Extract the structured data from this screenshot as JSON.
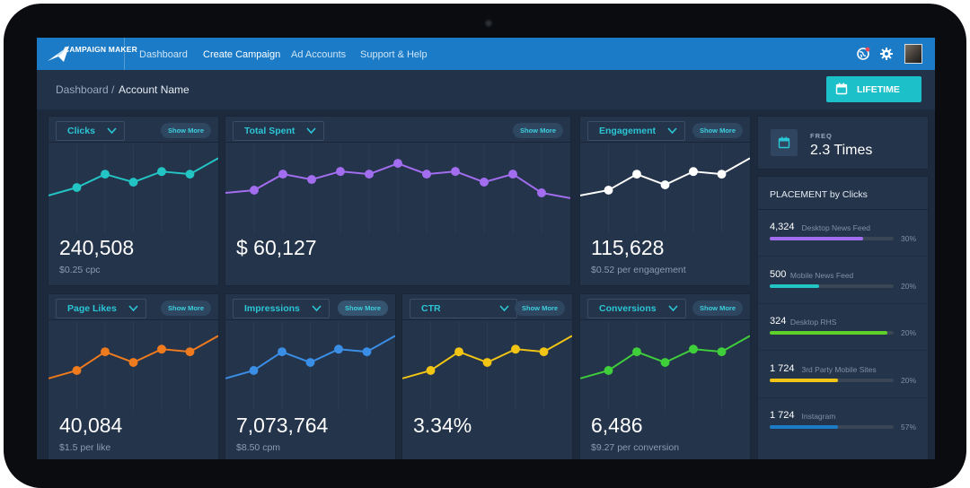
{
  "nav": {
    "logo_text": "CAMPAIGN MAKER",
    "items": [
      "Dashboard",
      "Create Campaign",
      "Ad Accounts",
      "Support & Help"
    ],
    "active_index": 1,
    "icons": [
      "globe-icon",
      "gear-icon",
      "avatar"
    ]
  },
  "breadcrumb": {
    "home": "Dashboard /",
    "current": "Account Name"
  },
  "date_range_button": {
    "label": "LIFETIME",
    "icon": "calendar-icon"
  },
  "show_more_label": "Show More",
  "colors": {
    "accent": "#1cc0c9",
    "nav": "#1b7bc7",
    "clicks": "#22c4c4",
    "total_spent": "#a36df0",
    "engagement": "#ffffff",
    "page_likes": "#f07b1f",
    "impressions": "#3a8ee6",
    "ctr": "#f2c515",
    "conversions": "#3fcf3a"
  },
  "cards": {
    "clicks": {
      "label": "Clicks",
      "value": "240,508",
      "sub": "$0.25 cpc",
      "trend": [
        2,
        3.5,
        6,
        4.5,
        6.5,
        6,
        9
      ]
    },
    "total_spent": {
      "label": "Total Spent",
      "value": "$ 60,127",
      "sub": "",
      "trend": [
        2.5,
        3,
        6,
        5,
        6.5,
        6,
        8,
        6,
        6.5,
        4.5,
        6,
        2.5,
        1.5
      ]
    },
    "engagement": {
      "label": "Engagement",
      "value": "115,628",
      "sub": "$0.52 per engagement",
      "trend": [
        2,
        3,
        6,
        4,
        6.5,
        6,
        9
      ]
    },
    "page_likes": {
      "label": "Page Likes",
      "value": "40,084",
      "sub": "$1.5 per like",
      "trend": [
        1,
        2.5,
        6,
        4,
        6.5,
        6,
        9
      ]
    },
    "impressions": {
      "label": "Impressions",
      "value": "7,073,764",
      "sub": "$8.50 cpm",
      "trend": [
        1,
        2.5,
        6,
        4,
        6.5,
        6,
        9
      ]
    },
    "ctr": {
      "label": "CTR",
      "value": "3.34%",
      "sub": "",
      "trend": [
        1,
        2.5,
        6,
        4,
        6.5,
        6,
        9
      ]
    },
    "conversions": {
      "label": "Conversions",
      "value": "6,486",
      "sub": "$9.27 per conversion",
      "trend": [
        1,
        2.5,
        6,
        4,
        6.5,
        6,
        9
      ]
    }
  },
  "freq": {
    "label": "FREQ",
    "value": "2.3 Times"
  },
  "placement": {
    "title": "PLACEMENT by Clicks",
    "rows": [
      {
        "count": "4,324",
        "name": "Desktop News Feed",
        "pct": "30%",
        "fill": 0.75,
        "color": "#a36df0"
      },
      {
        "count": "500",
        "name": "Mobile News Feed",
        "pct": "20%",
        "fill": 0.4,
        "color": "#22c4c4"
      },
      {
        "count": "324",
        "name": "Desktop RHS",
        "pct": "20%",
        "fill": 0.95,
        "color": "#5fcf2a"
      },
      {
        "count": "1 724",
        "name": "3rd Party Mobile Sites",
        "pct": "20%",
        "fill": 0.55,
        "color": "#f2c515"
      },
      {
        "count": "1 724",
        "name": "Instagram",
        "pct": "57%",
        "fill": 0.55,
        "color": "#1b7bc7"
      }
    ]
  }
}
